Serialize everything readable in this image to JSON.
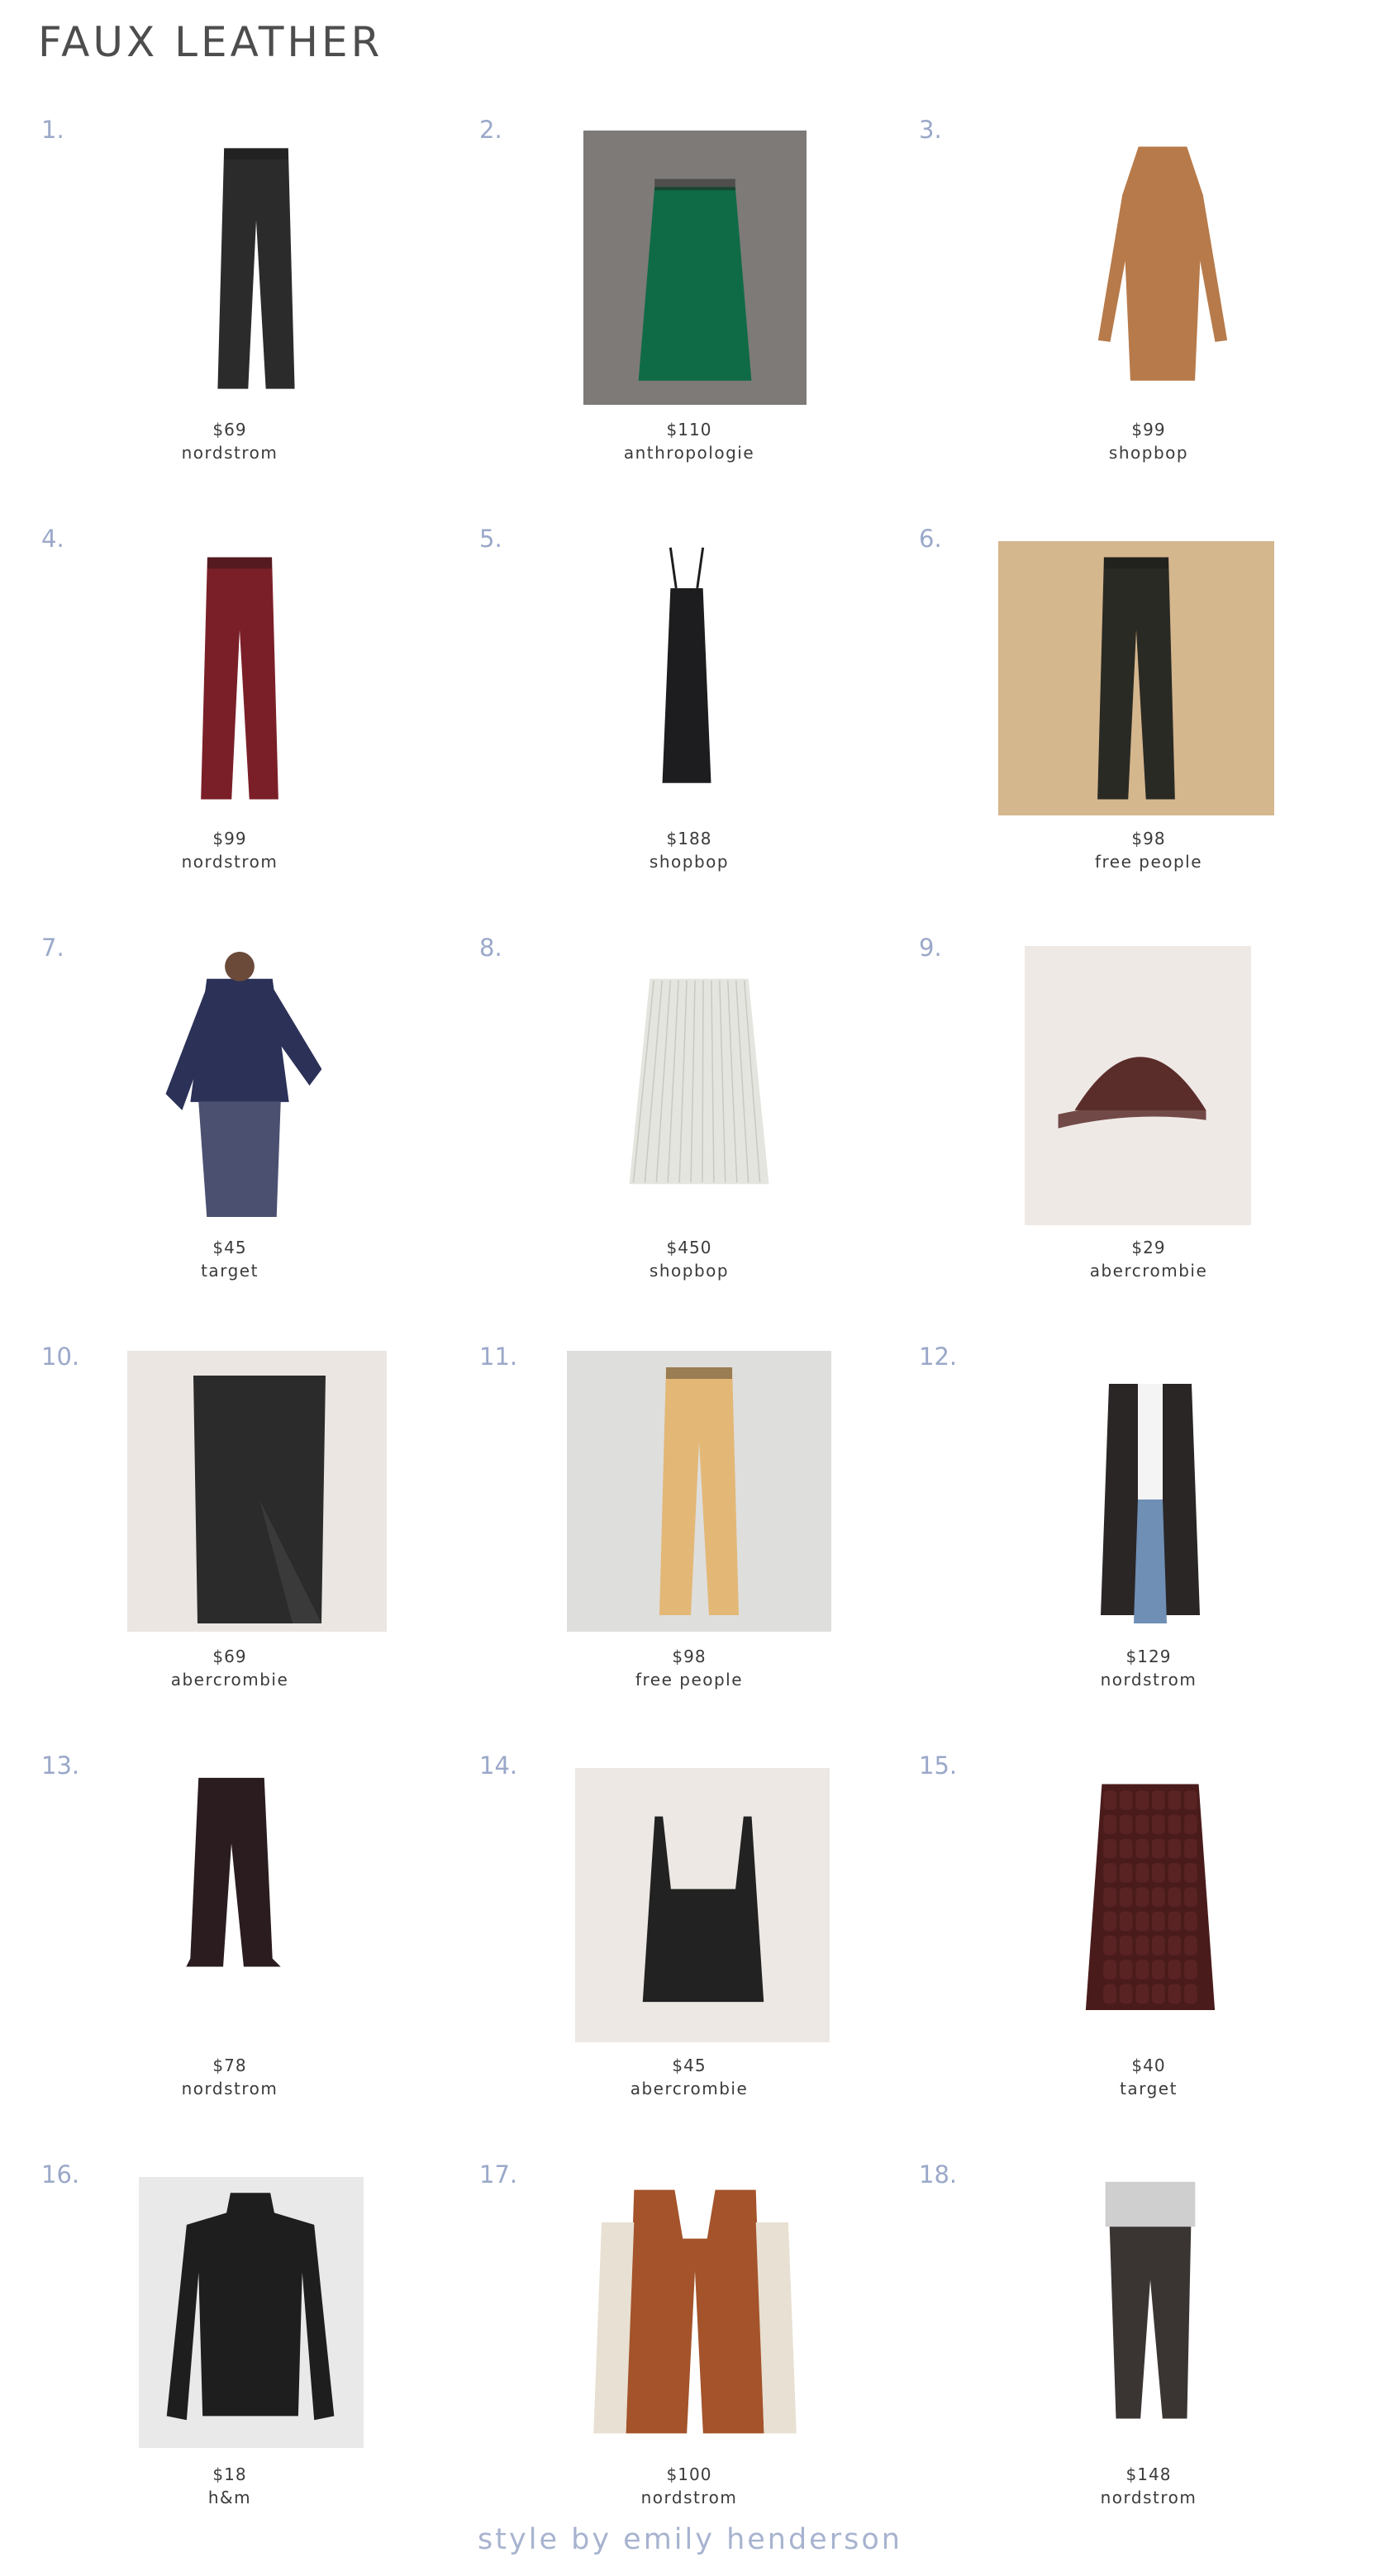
{
  "title": "FAUX LEATHER",
  "footer": "style by emily henderson",
  "items": [
    {
      "number": "1.",
      "price": "$69",
      "store": "nordstrom"
    },
    {
      "number": "2.",
      "price": "$110",
      "store": "anthropologie"
    },
    {
      "number": "3.",
      "price": "$99",
      "store": "shopbop"
    },
    {
      "number": "4.",
      "price": "$99",
      "store": "nordstrom"
    },
    {
      "number": "5.",
      "price": "$188",
      "store": "shopbop"
    },
    {
      "number": "6.",
      "price": "$98",
      "store": "free people"
    },
    {
      "number": "7.",
      "price": "$45",
      "store": "target"
    },
    {
      "number": "8.",
      "price": "$450",
      "store": "shopbop"
    },
    {
      "number": "9.",
      "price": "$29",
      "store": "abercrombie"
    },
    {
      "number": "10.",
      "price": "$69",
      "store": "abercrombie"
    },
    {
      "number": "11.",
      "price": "$98",
      "store": "free people"
    },
    {
      "number": "12.",
      "price": "$129",
      "store": "nordstrom"
    },
    {
      "number": "13.",
      "price": "$78",
      "store": "nordstrom"
    },
    {
      "number": "14.",
      "price": "$45",
      "store": "abercrombie"
    },
    {
      "number": "15.",
      "price": "$40",
      "store": "target"
    },
    {
      "number": "16.",
      "price": "$18",
      "store": "h&m"
    },
    {
      "number": "17.",
      "price": "$100",
      "store": "nordstrom"
    },
    {
      "number": "18.",
      "price": "$148",
      "store": "nordstrom"
    }
  ],
  "products": [
    {
      "name": "leather-pants-icon",
      "color": "#2b2b2b"
    },
    {
      "name": "green-croc-skirt-icon",
      "color": "#0f6b45"
    },
    {
      "name": "camel-shirt-dress-icon",
      "color": "#b77a4a"
    },
    {
      "name": "burgundy-trousers-icon",
      "color": "#7a1f28"
    },
    {
      "name": "slip-dress-icon",
      "color": "#1d1d1f"
    },
    {
      "name": "flare-pants-icon",
      "color": "#2a2a24"
    },
    {
      "name": "navy-blouse-icon",
      "color": "#2b3157"
    },
    {
      "name": "pleated-skirt-icon",
      "color": "#e5e5df"
    },
    {
      "name": "baseball-cap-icon",
      "color": "#5a2d2a"
    },
    {
      "name": "pencil-skirt-icon",
      "color": "#2b2b2b"
    },
    {
      "name": "tan-pants-icon",
      "color": "#e3b776"
    },
    {
      "name": "blazer-icon",
      "color": "#2a2626"
    },
    {
      "name": "cropped-flare-pants-icon",
      "color": "#2a1c1f"
    },
    {
      "name": "tank-top-icon",
      "color": "#222222"
    },
    {
      "name": "croc-midi-skirt-icon",
      "color": "#4a1b1b"
    },
    {
      "name": "mock-neck-top-icon",
      "color": "#1e1e1e"
    },
    {
      "name": "puffer-vest-icon",
      "color": "#a4532a"
    },
    {
      "name": "jogger-pants-icon",
      "color": "#3a3532"
    }
  ]
}
